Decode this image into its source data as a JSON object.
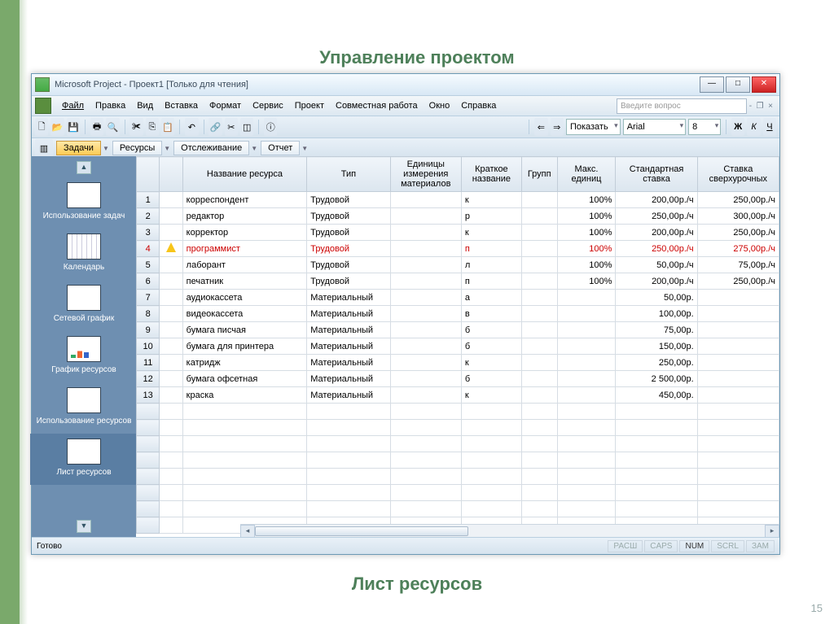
{
  "slide": {
    "title": "Управление проектом",
    "subtitle": "Лист ресурсов",
    "page": "15"
  },
  "window": {
    "title": "Microsoft Project - Проект1 [Только для чтения]",
    "helpPrompt": "Введите вопрос"
  },
  "menu": [
    "Файл",
    "Правка",
    "Вид",
    "Вставка",
    "Формат",
    "Сервис",
    "Проект",
    "Совместная работа",
    "Окно",
    "Справка"
  ],
  "toolbar": {
    "show": "Показать",
    "font": "Arial",
    "fontsize": "8"
  },
  "viewbar": [
    "Задачи",
    "Ресурсы",
    "Отслеживание",
    "Отчет"
  ],
  "sidebar": [
    "Использование задач",
    "Календарь",
    "Сетевой график",
    "График ресурсов",
    "Использование ресурсов",
    "Лист ресурсов"
  ],
  "grid": {
    "columns": [
      "",
      "",
      "Название ресурса",
      "Тип",
      "Единицы измерения материалов",
      "Краткое название",
      "Групп",
      "Макс. единиц",
      "Стандартная ставка",
      "Ставка сверхурочных"
    ],
    "widths": [
      26,
      26,
      140,
      94,
      80,
      68,
      40,
      66,
      92,
      92
    ],
    "rows": [
      {
        "n": 1,
        "warn": false,
        "name": "корреспондент",
        "type": "Трудовой",
        "unit": "",
        "short": "к",
        "group": "",
        "max": "100%",
        "rate": "200,00р./ч",
        "ot": "250,00р./ч"
      },
      {
        "n": 2,
        "warn": false,
        "name": "редактор",
        "type": "Трудовой",
        "unit": "",
        "short": "р",
        "group": "",
        "max": "100%",
        "rate": "250,00р./ч",
        "ot": "300,00р./ч"
      },
      {
        "n": 3,
        "warn": false,
        "name": "корректор",
        "type": "Трудовой",
        "unit": "",
        "short": "к",
        "group": "",
        "max": "100%",
        "rate": "200,00р./ч",
        "ot": "250,00р./ч"
      },
      {
        "n": 4,
        "warn": true,
        "red": true,
        "name": "программист",
        "type": "Трудовой",
        "unit": "",
        "short": "п",
        "group": "",
        "max": "100%",
        "rate": "250,00р./ч",
        "ot": "275,00р./ч"
      },
      {
        "n": 5,
        "warn": false,
        "name": "лаборант",
        "type": "Трудовой",
        "unit": "",
        "short": "л",
        "group": "",
        "max": "100%",
        "rate": "50,00р./ч",
        "ot": "75,00р./ч"
      },
      {
        "n": 6,
        "warn": false,
        "name": "печатник",
        "type": "Трудовой",
        "unit": "",
        "short": "п",
        "group": "",
        "max": "100%",
        "rate": "200,00р./ч",
        "ot": "250,00р./ч"
      },
      {
        "n": 7,
        "warn": false,
        "name": "аудиокассета",
        "type": "Материальный",
        "unit": "",
        "short": "а",
        "group": "",
        "max": "",
        "rate": "50,00р.",
        "ot": ""
      },
      {
        "n": 8,
        "warn": false,
        "name": "видеокассета",
        "type": "Материальный",
        "unit": "",
        "short": "в",
        "group": "",
        "max": "",
        "rate": "100,00р.",
        "ot": ""
      },
      {
        "n": 9,
        "warn": false,
        "name": "бумага писчая",
        "type": "Материальный",
        "unit": "",
        "short": "б",
        "group": "",
        "max": "",
        "rate": "75,00р.",
        "ot": ""
      },
      {
        "n": 10,
        "warn": false,
        "name": "бумага для принтера",
        "type": "Материальный",
        "unit": "",
        "short": "б",
        "group": "",
        "max": "",
        "rate": "150,00р.",
        "ot": ""
      },
      {
        "n": 11,
        "warn": false,
        "name": "катридж",
        "type": "Материальный",
        "unit": "",
        "short": "к",
        "group": "",
        "max": "",
        "rate": "250,00р.",
        "ot": ""
      },
      {
        "n": 12,
        "warn": false,
        "name": "бумага офсетная",
        "type": "Материальный",
        "unit": "",
        "short": "б",
        "group": "",
        "max": "",
        "rate": "2 500,00р.",
        "ot": ""
      },
      {
        "n": 13,
        "warn": false,
        "name": "краска",
        "type": "Материальный",
        "unit": "",
        "short": "к",
        "group": "",
        "max": "",
        "rate": "450,00р.",
        "ot": ""
      }
    ],
    "emptyRows": 8
  },
  "status": {
    "ready": "Готово",
    "ext": "РАСШ",
    "caps": "CAPS",
    "num": "NUM",
    "scrl": "SCRL",
    "ovr": "ЗАМ"
  }
}
